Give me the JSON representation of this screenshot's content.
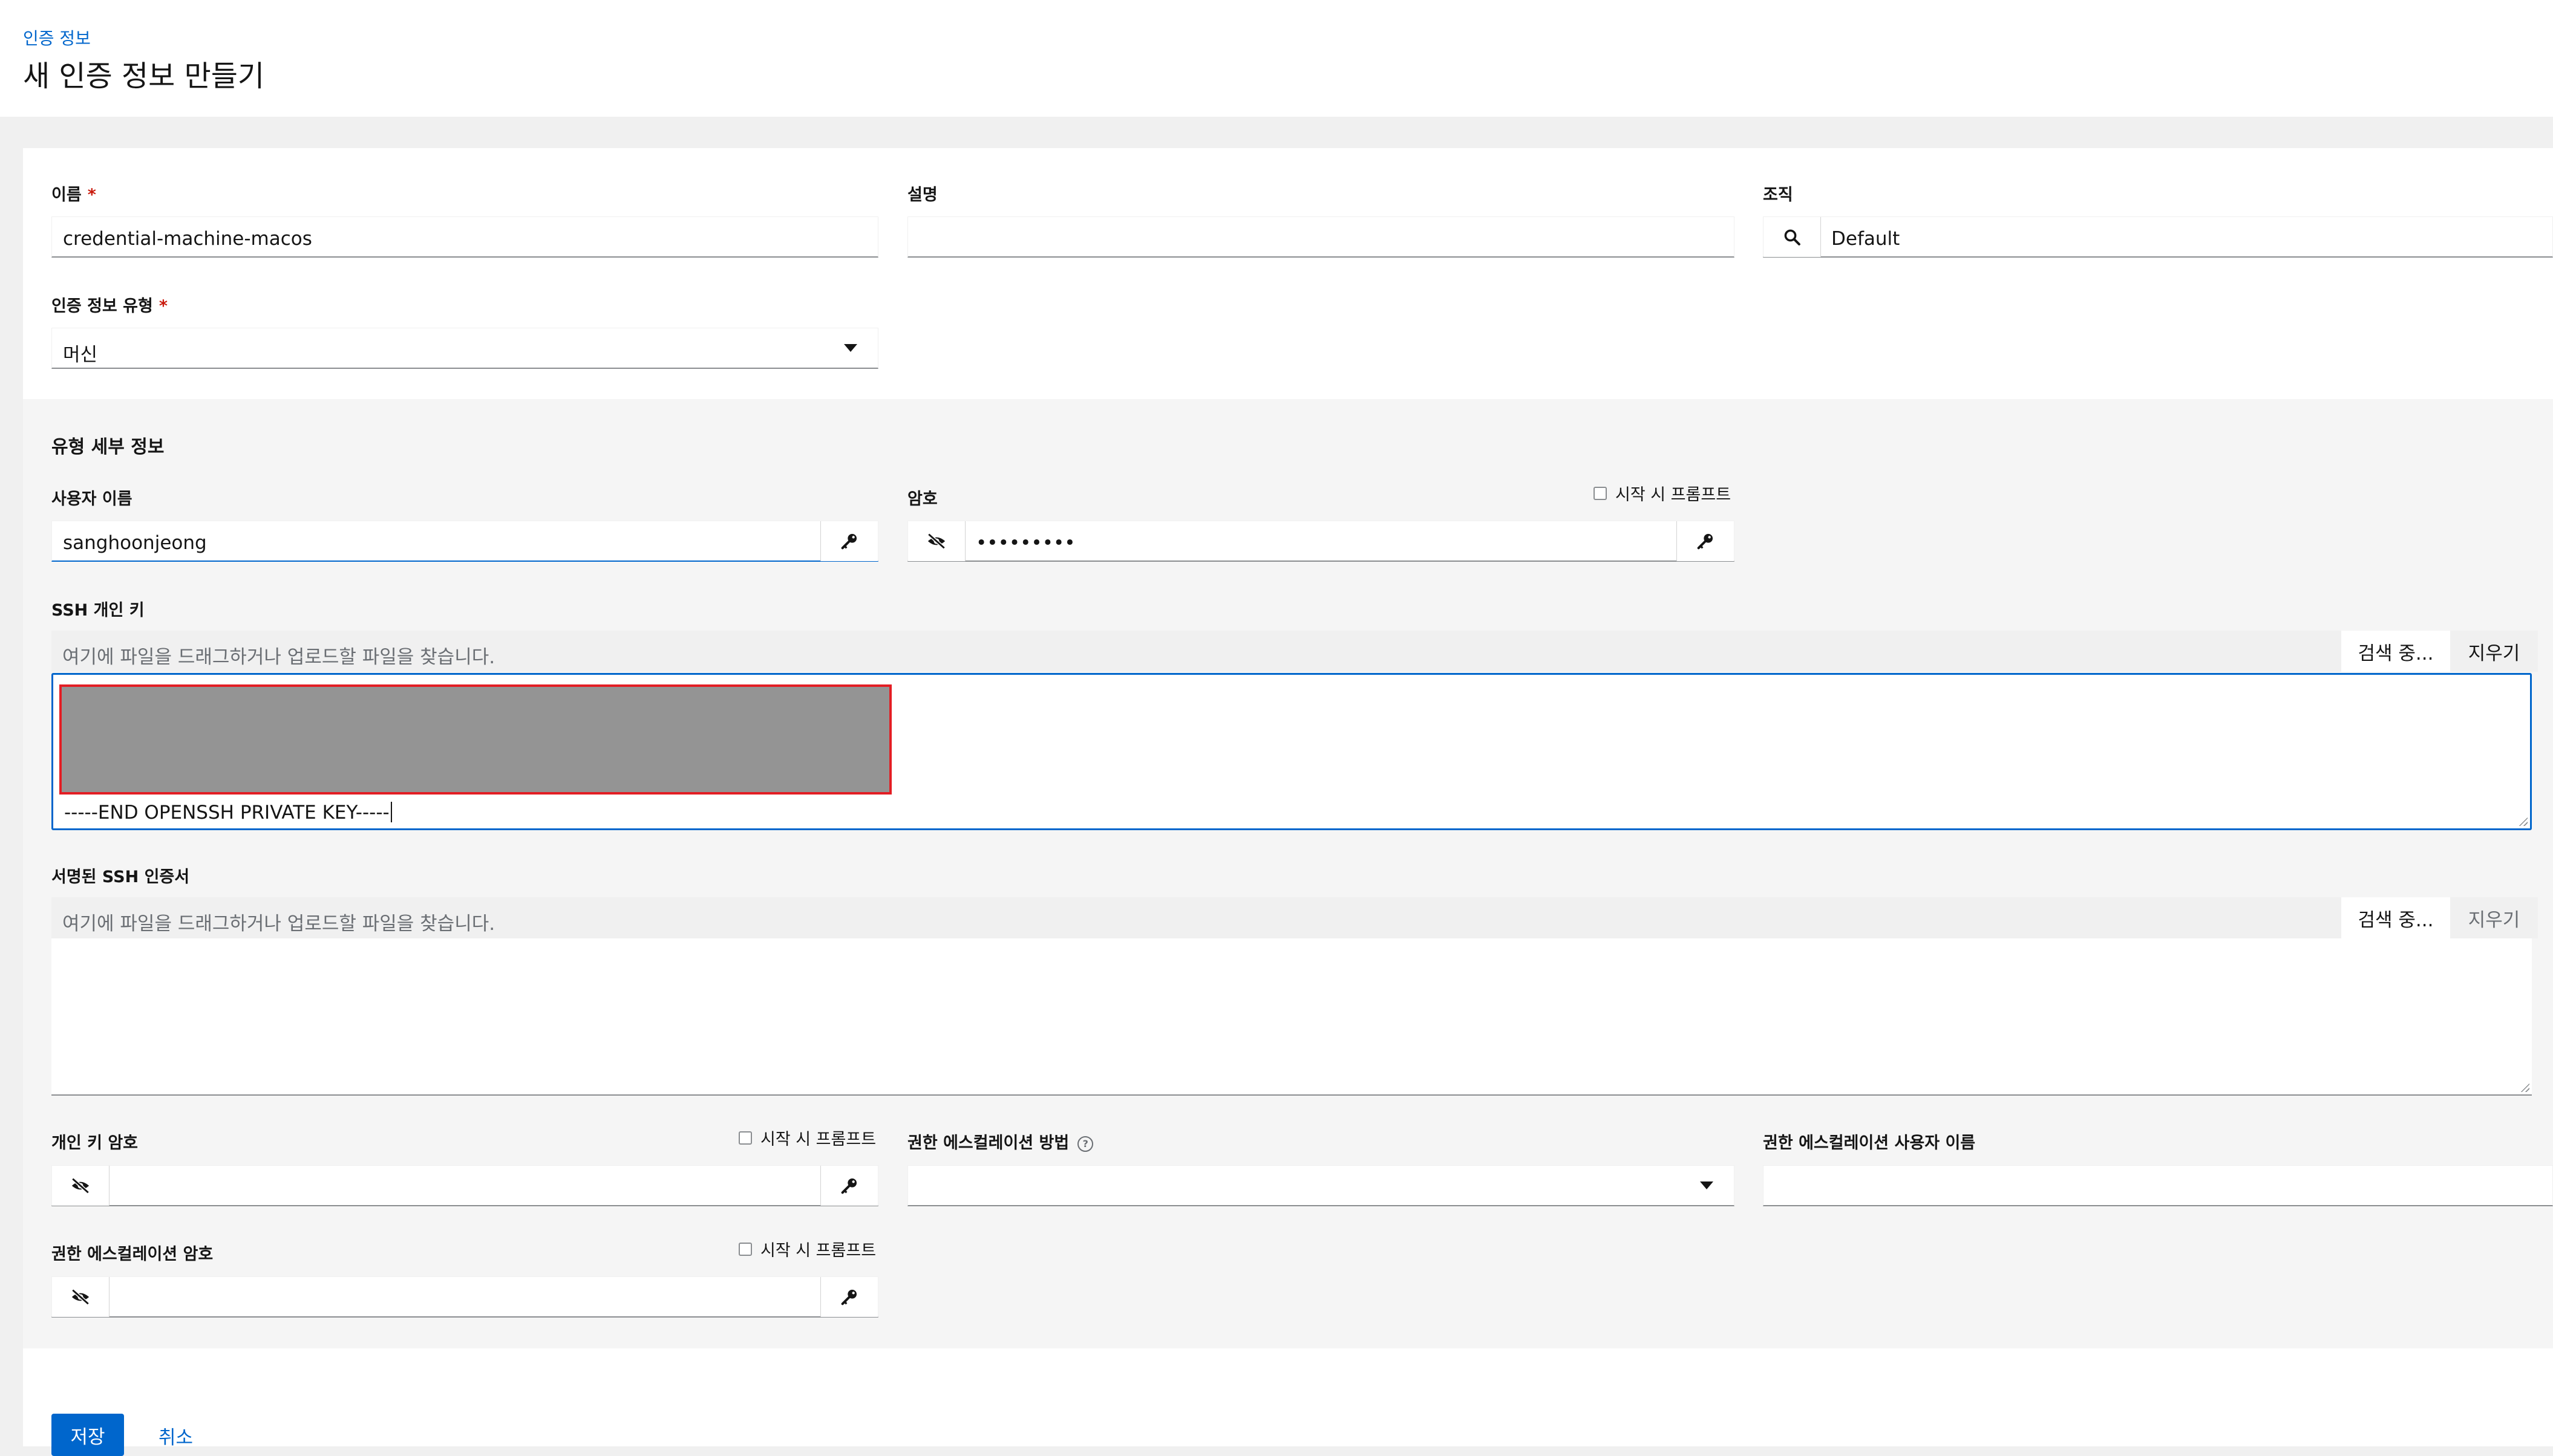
{
  "breadcrumb": "인증 정보",
  "page_title": "새 인증 정보 만들기",
  "form": {
    "name_label": "이름",
    "name_value": "credential-machine-macos",
    "required_mark": "*",
    "description_label": "설명",
    "description_value": "",
    "organization_label": "조직",
    "organization_value": "Default",
    "credential_type_label": "인증 정보 유형",
    "credential_type_value": "머신"
  },
  "type_details": {
    "section_title": "유형 세부 정보",
    "username_label": "사용자 이름",
    "username_value": "sanghoonjeong",
    "password_label": "암호",
    "password_value": "•••••••••",
    "prompt_on_launch": "시작 시 프롬프트",
    "ssh_key_label": "SSH 개인 키",
    "file_placeholder": "여기에 파일을 드래그하거나 업로드할 파일을 찾습니다.",
    "browse_label": "검색 중...",
    "clear_label": "지우기",
    "ssh_key_tail": "-----END OPENSSH PRIVATE KEY-----",
    "signed_cert_label": "서명된 SSH 인증서",
    "key_passphrase_label": "개인 키 암호",
    "escalation_method_label": "권한 에스컬레이션 방법",
    "escalation_method_value": "",
    "escalation_username_label": "권한 에스컬레이션 사용자 이름",
    "escalation_password_label": "권한 에스컬레이션 암호"
  },
  "actions": {
    "save_label": "저장",
    "cancel_label": "취소"
  },
  "colors": {
    "accent": "#0066cc",
    "required": "#c9190b",
    "redaction_border": "#e31e24"
  },
  "icons": {
    "search": "search-icon",
    "key": "key-icon",
    "eye_slash": "eye-slash-icon",
    "help": "help-icon",
    "caret_down": "caret-down-icon"
  }
}
